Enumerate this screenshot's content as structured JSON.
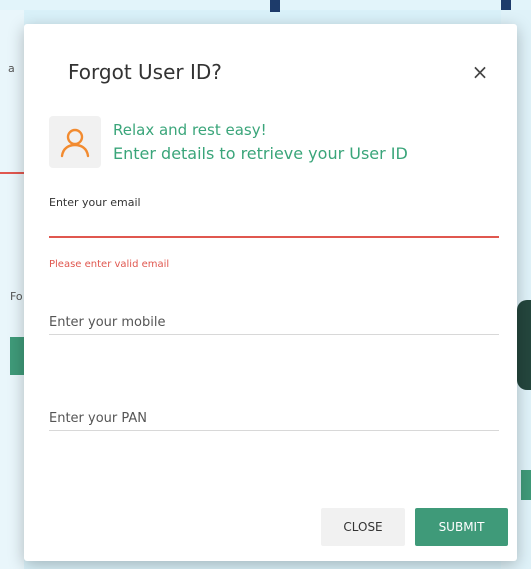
{
  "background": {
    "left_snippet_1": "a",
    "left_snippet_2": "Fo"
  },
  "dialog": {
    "title": "Forgot User ID?",
    "close_glyph": "×",
    "avatar_icon": "user-outline-icon",
    "hero_line1": "Relax and rest easy!",
    "hero_line2": "Enter details to retrieve your User ID",
    "email": {
      "label": "Enter your email",
      "value": "",
      "error": "Please enter valid email"
    },
    "mobile": {
      "placeholder": "Enter your mobile",
      "value": ""
    },
    "pan": {
      "placeholder": "Enter your PAN",
      "value": ""
    },
    "buttons": {
      "close": "CLOSE",
      "submit": "SUBMIT"
    }
  },
  "colors": {
    "accent_green": "#3f9a79",
    "hero_text_green": "#3aa57a",
    "error_red": "#e0574f",
    "avatar_orange": "#f28b30"
  }
}
